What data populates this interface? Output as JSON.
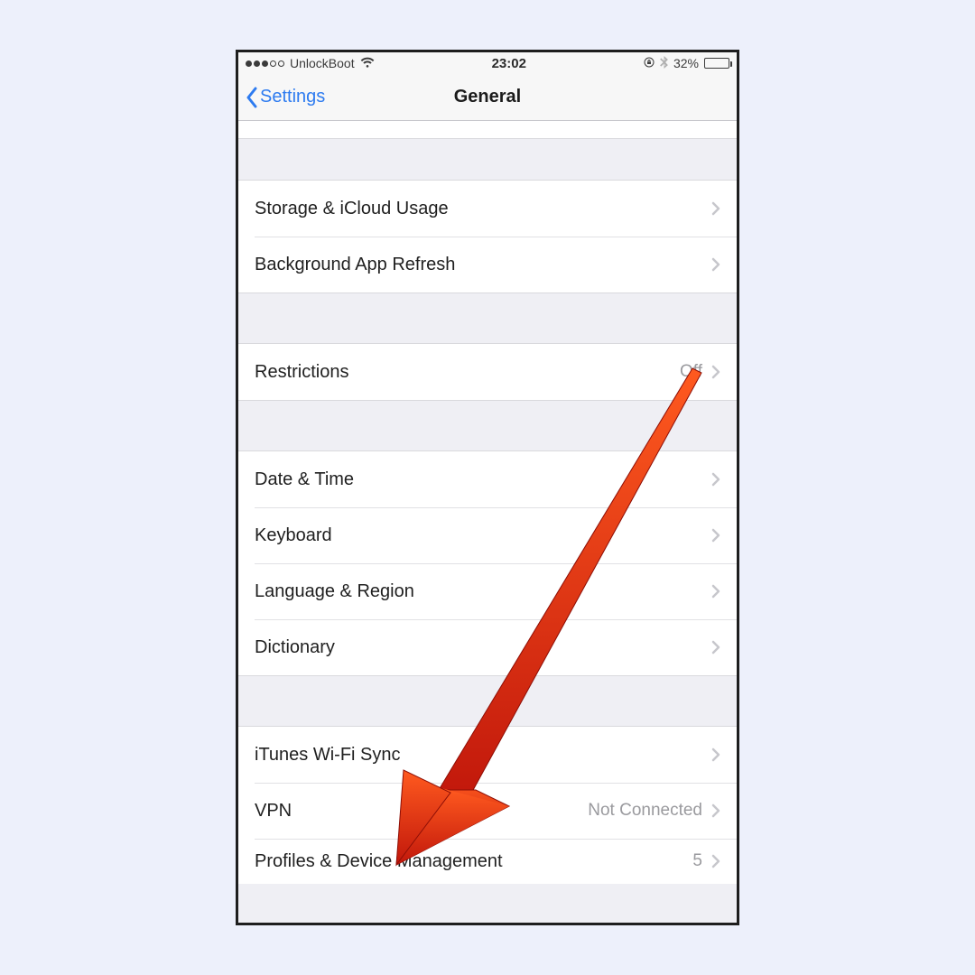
{
  "status": {
    "carrier": "UnlockBoot",
    "time": "23:02",
    "battery_pct": "32%",
    "battery_level": 32
  },
  "nav": {
    "back_label": "Settings",
    "title": "General"
  },
  "groups": [
    {
      "rows": [
        {
          "label": "Storage & iCloud Usage",
          "value": ""
        },
        {
          "label": "Background App Refresh",
          "value": ""
        }
      ]
    },
    {
      "rows": [
        {
          "label": "Restrictions",
          "value": "Off"
        }
      ]
    },
    {
      "rows": [
        {
          "label": "Date & Time",
          "value": ""
        },
        {
          "label": "Keyboard",
          "value": ""
        },
        {
          "label": "Language & Region",
          "value": ""
        },
        {
          "label": "Dictionary",
          "value": ""
        }
      ]
    },
    {
      "rows": [
        {
          "label": "iTunes Wi-Fi Sync",
          "value": ""
        },
        {
          "label": "VPN",
          "value": "Not Connected"
        },
        {
          "label": "Profiles & Device Management",
          "value": "5"
        }
      ]
    }
  ]
}
